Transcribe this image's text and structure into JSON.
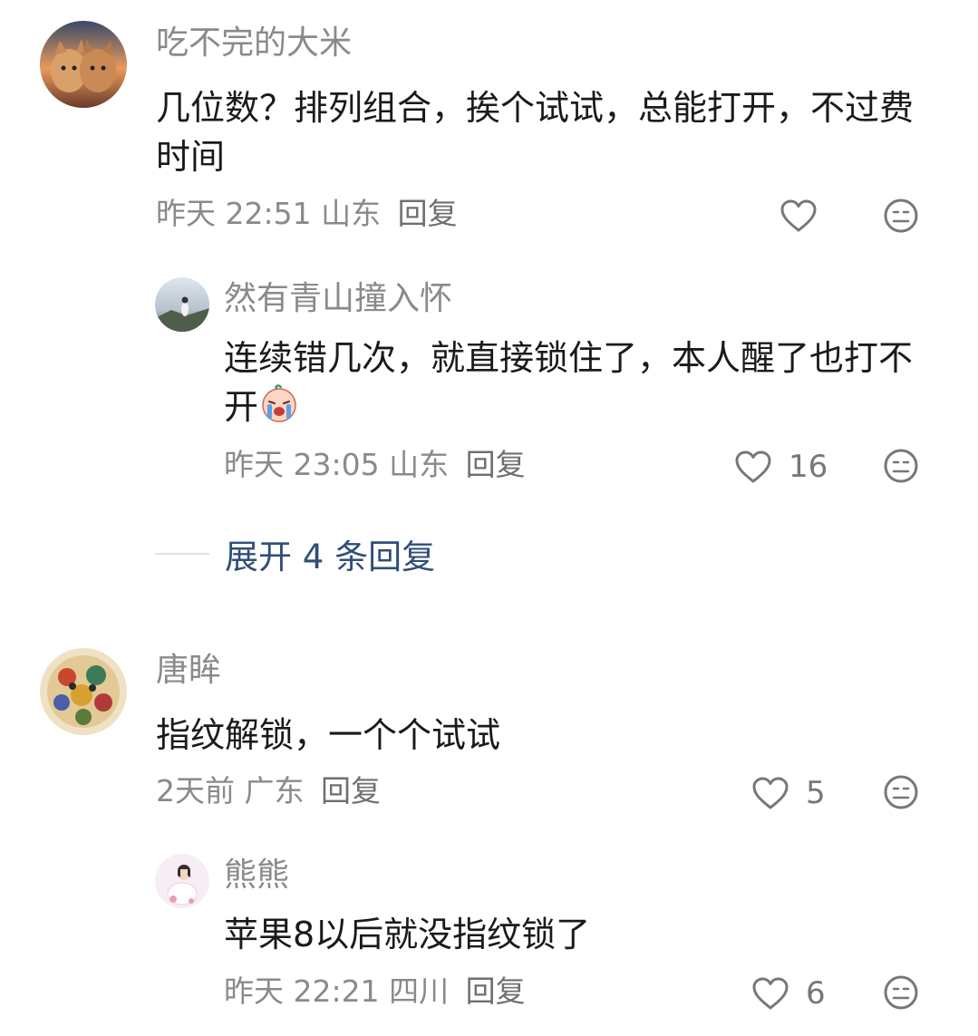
{
  "comments": [
    {
      "user": "吃不完的大米",
      "text": "几位数？排列组合，挨个试试，总能打开，不过费时间",
      "time": "昨天 22:51",
      "location": "山东",
      "reply_label": "回复",
      "likes": ""
    },
    {
      "user": "然有青山撞入怀",
      "text": "连续错几次，就直接锁住了，本人醒了也打不开",
      "time": "昨天 23:05",
      "location": "山东",
      "reply_label": "回复",
      "likes": "16"
    },
    {
      "user": "唐眸",
      "text": "指纹解锁，一个个试试",
      "time": "2天前",
      "location": "广东",
      "reply_label": "回复",
      "likes": "5"
    },
    {
      "user": "熊熊",
      "text": "苹果8以后就没指纹锁了",
      "time": "昨天 22:21",
      "location": "四川",
      "reply_label": "回复",
      "likes": "6"
    }
  ],
  "expand_replies": "展开 4 条回复",
  "icons": {
    "like": "heart-outline-icon",
    "dislike": "meh-face-icon",
    "emoji": "crying-face-emoji"
  },
  "colors": {
    "secondary_text": "#8a8a8a",
    "primary_text": "#1a1a1a",
    "link": "#2f4e78"
  }
}
